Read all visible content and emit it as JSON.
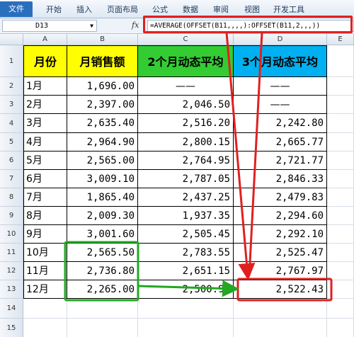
{
  "ribbon": {
    "file_label": "文件",
    "tabs": [
      "开始",
      "插入",
      "页面布局",
      "公式",
      "数据",
      "审阅",
      "视图",
      "开发工具"
    ]
  },
  "formula_bar": {
    "name_box": "D13",
    "fx_label": "fx",
    "formula": "=AVERAGE(OFFSET(B11,,,,):OFFSET(B11,2,,,))"
  },
  "columns": [
    "A",
    "B",
    "C",
    "D",
    "E"
  ],
  "table": {
    "headers": [
      "月份",
      "月销售额",
      "2个月动态平均",
      "3个月动态平均"
    ],
    "rows": [
      {
        "n": "2",
        "month": "1月",
        "sales": "1,696.00",
        "avg2": "——",
        "avg3": "——"
      },
      {
        "n": "3",
        "month": "2月",
        "sales": "2,397.00",
        "avg2": "2,046.50",
        "avg3": "——"
      },
      {
        "n": "4",
        "month": "3月",
        "sales": "2,635.40",
        "avg2": "2,516.20",
        "avg3": "2,242.80"
      },
      {
        "n": "5",
        "month": "4月",
        "sales": "2,964.90",
        "avg2": "2,800.15",
        "avg3": "2,665.77"
      },
      {
        "n": "6",
        "month": "5月",
        "sales": "2,565.00",
        "avg2": "2,764.95",
        "avg3": "2,721.77"
      },
      {
        "n": "7",
        "month": "6月",
        "sales": "3,009.10",
        "avg2": "2,787.05",
        "avg3": "2,846.33"
      },
      {
        "n": "8",
        "month": "7月",
        "sales": "1,865.40",
        "avg2": "2,437.25",
        "avg3": "2,479.83"
      },
      {
        "n": "9",
        "month": "8月",
        "sales": "2,009.30",
        "avg2": "1,937.35",
        "avg3": "2,294.60"
      },
      {
        "n": "10",
        "month": "9月",
        "sales": "3,001.60",
        "avg2": "2,505.45",
        "avg3": "2,292.10"
      },
      {
        "n": "11",
        "month": "10月",
        "sales": "2,565.50",
        "avg2": "2,783.55",
        "avg3": "2,525.47"
      },
      {
        "n": "12",
        "month": "11月",
        "sales": "2,736.80",
        "avg2": "2,651.15",
        "avg3": "2,767.97"
      },
      {
        "n": "13",
        "month": "12月",
        "sales": "2,265.00",
        "avg2": "2,500.90",
        "avg3": "2,522.43"
      }
    ],
    "extra_rows": [
      "14",
      "15"
    ]
  },
  "colors": {
    "header_yellow": "#ffff00",
    "header_green": "#33cc33",
    "header_blue": "#00b0f0",
    "highlight_red": "#e02020",
    "highlight_green": "#22a822"
  }
}
